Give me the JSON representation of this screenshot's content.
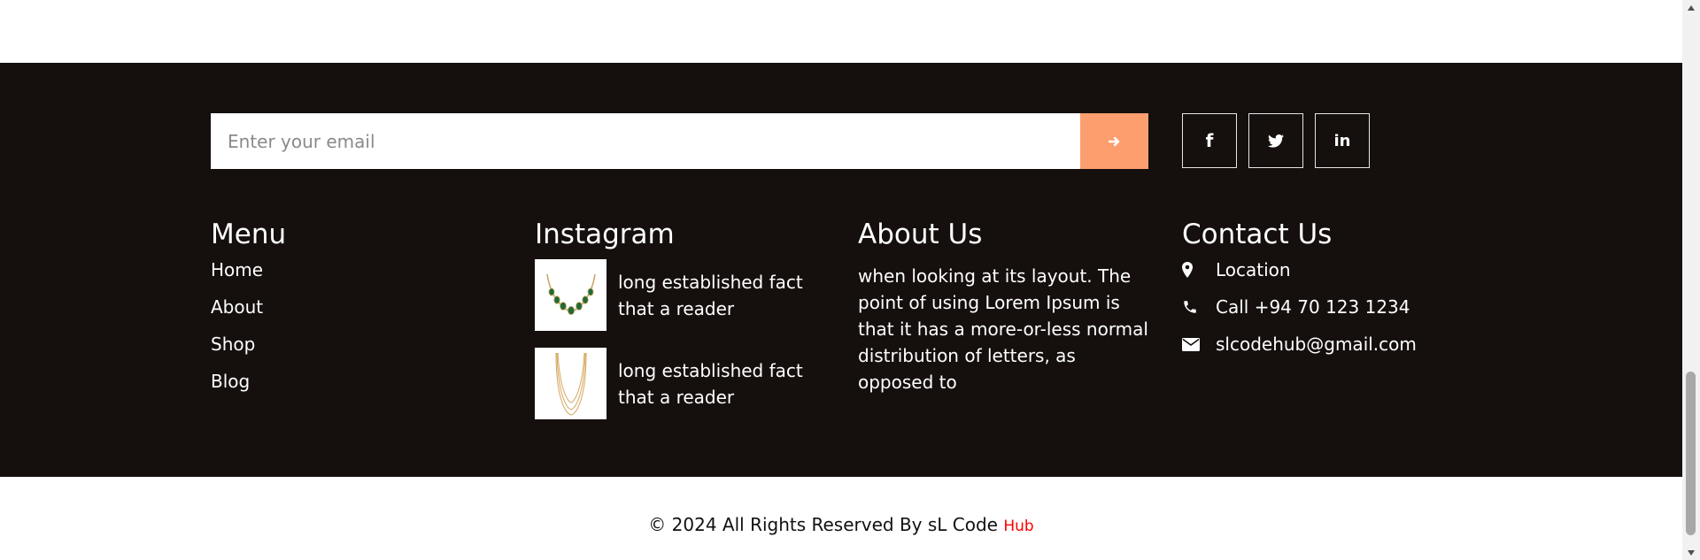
{
  "newsletter": {
    "email_placeholder": "Enter your email",
    "submit_icon": "arrow-right-icon"
  },
  "socials": [
    {
      "icon": "facebook-icon",
      "label": "f"
    },
    {
      "icon": "twitter-icon"
    },
    {
      "icon": "linkedin-icon",
      "label": "in"
    }
  ],
  "menu": {
    "title": "Menu",
    "items": [
      "Home",
      "About",
      "Shop",
      "Blog"
    ]
  },
  "instagram": {
    "title": "Instagram",
    "posts": [
      {
        "text": "long established fact that a reader",
        "image": "emerald-necklace"
      },
      {
        "text": "long established fact that a reader",
        "image": "gold-layered-necklace"
      }
    ]
  },
  "about": {
    "title": "About Us",
    "text": "when looking at its layout. The point of using Lorem Ipsum is that it has a more-or-less normal distribution of letters, as opposed to"
  },
  "contact": {
    "title": "Contact Us",
    "location": "Location",
    "phone": "Call +94 70 123 1234",
    "email": "slcodehub@gmail.com"
  },
  "copyright": {
    "text": "© 2024 All Rights Reserved By sL Code",
    "accent": "Hub"
  },
  "colors": {
    "footer_bg": "#15100e",
    "accent": "#fd9e6f",
    "brand_red": "#ff0000"
  }
}
